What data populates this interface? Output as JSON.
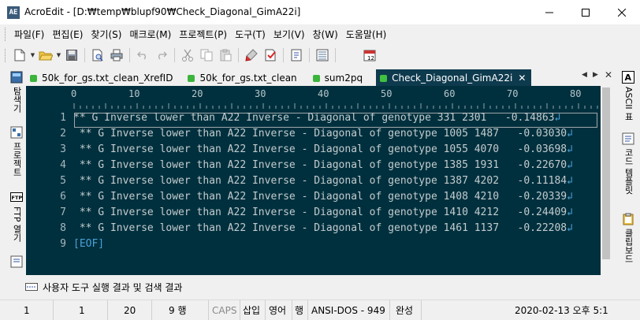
{
  "window": {
    "app_name": "AcroEdit",
    "title": "AcroEdit - [D:₩temp₩blupf90₩Check_Diagonal_GimA22i]",
    "minimize_icon": "minimize-icon",
    "maximize_icon": "maximize-icon",
    "close_icon": "close-icon"
  },
  "menu": [
    "파일(F)",
    "편집(E)",
    "찾기(S)",
    "매크로(M)",
    "프로젝트(P)",
    "도구(T)",
    "보기(V)",
    "창(W)",
    "도움말(H)"
  ],
  "toolbar": {
    "icons": [
      "new-file-icon",
      "open-folder-icon",
      "save-icon",
      "print-preview-icon",
      "print-icon",
      "undo-icon",
      "redo-icon",
      "cut-icon",
      "copy-icon",
      "paste-icon",
      "highlighter-icon",
      "bookmark-icon",
      "file-properties-icon",
      "list-icon",
      "calendar-icon"
    ]
  },
  "left_panel": {
    "tabs": [
      "탐색기",
      "프로젝트",
      "FTP 열기"
    ]
  },
  "right_panel": {
    "tabs": [
      "ASCII 표",
      "코드 템플릿",
      "클립보드"
    ]
  },
  "tabs": [
    {
      "label": "50k_for_gs.txt_clean_XrefID",
      "active": false
    },
    {
      "label": "50k_for_gs.txt_clean",
      "active": false
    },
    {
      "label": "sum2pq",
      "active": false
    },
    {
      "label": "Check_Diagonal_GimA22i",
      "active": true
    }
  ],
  "editor": {
    "ruler_labels": [
      "0",
      "10",
      "20",
      "30",
      "40",
      "50",
      "60",
      "70",
      "80"
    ],
    "lines": [
      {
        "num": "1",
        "text": "** G Inverse lower than A22 Inverse - Diagonal of genotype 331 2301   -0.14863"
      },
      {
        "num": "2",
        "text": " ** G Inverse lower than A22 Inverse - Diagonal of genotype 1005 1487   -0.03030"
      },
      {
        "num": "3",
        "text": " ** G Inverse lower than A22 Inverse - Diagonal of genotype 1055 4070   -0.03698"
      },
      {
        "num": "4",
        "text": " ** G Inverse lower than A22 Inverse - Diagonal of genotype 1385 1931   -0.22670"
      },
      {
        "num": "5",
        "text": " ** G Inverse lower than A22 Inverse - Diagonal of genotype 1387 4202   -0.11184"
      },
      {
        "num": "6",
        "text": " ** G Inverse lower than A22 Inverse - Diagonal of genotype 1408 4210   -0.20339"
      },
      {
        "num": "7",
        "text": " ** G Inverse lower than A22 Inverse - Diagonal of genotype 1410 4212   -0.24409"
      },
      {
        "num": "8",
        "text": " ** G Inverse lower than A22 Inverse - Diagonal of genotype 1461 1137   -0.22208"
      },
      {
        "num": "9",
        "text": "[EOF]"
      }
    ],
    "eol_marker": "↲"
  },
  "output": {
    "label": "사용자 도구 실행 결과 및 검색 결과"
  },
  "status": {
    "col1": "1",
    "col2": "1",
    "col3": "20",
    "lines": "9 행",
    "caps": "CAPS",
    "insert": "삽입",
    "lang": "영어",
    "row": "행",
    "encoding": "ANSI-DOS - 949",
    "state": "완성",
    "datetime": "2020-02-13 오후 5:1"
  }
}
